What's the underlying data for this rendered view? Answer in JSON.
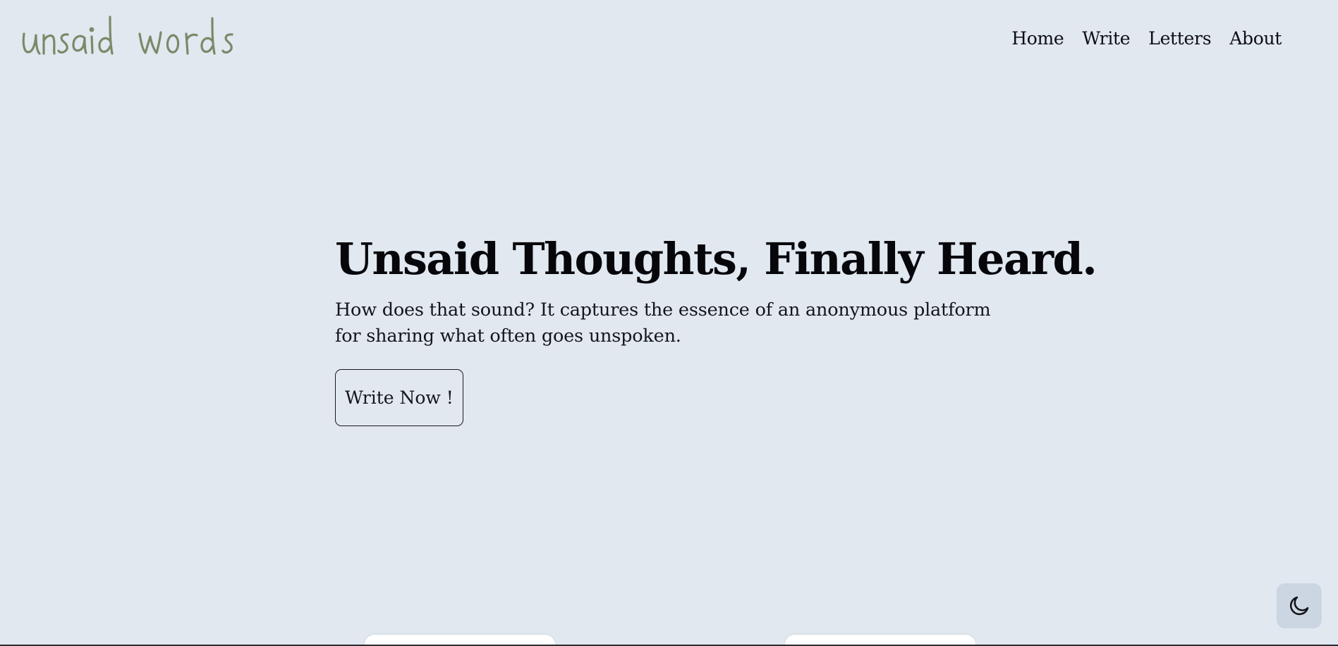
{
  "brand": {
    "logo_text": "unsaid words",
    "logo_color": "#7a8a68"
  },
  "nav": {
    "items": [
      {
        "label": "Home"
      },
      {
        "label": "Write"
      },
      {
        "label": "Letters"
      },
      {
        "label": "About"
      }
    ]
  },
  "hero": {
    "title": "Unsaid Thoughts, Finally Heard.",
    "subtitle": "How does that sound? It captures the essence of an anonymous platform for sharing what often goes unspoken.",
    "cta_label": "Write Now !"
  },
  "theme_toggle": {
    "icon": "moon-icon"
  },
  "colors": {
    "background": "#e1e8f0",
    "text": "#0d0d12",
    "toggle_bg": "#cbd6e2",
    "card_bg": "#ffffff"
  }
}
